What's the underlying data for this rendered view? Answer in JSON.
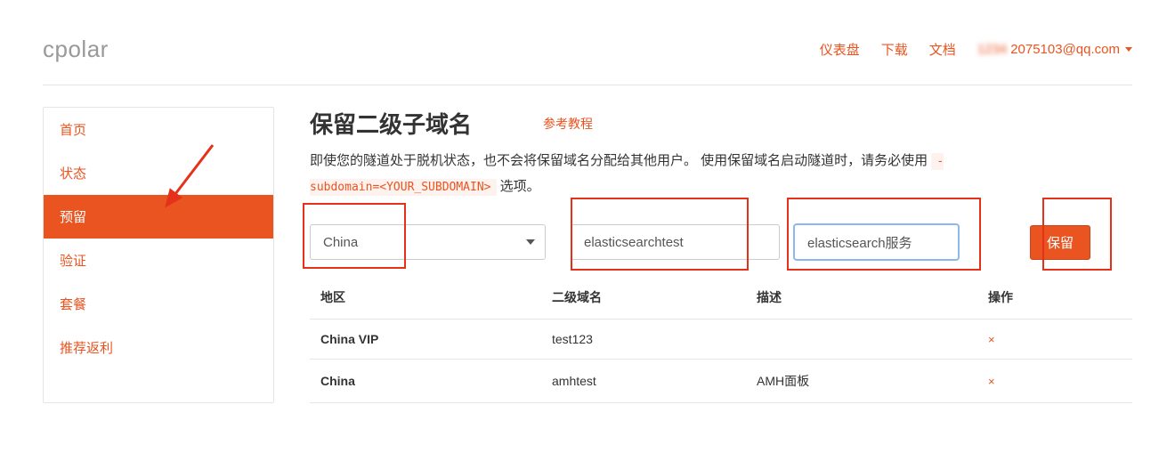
{
  "brand": "cpolar",
  "nav": {
    "dashboard": "仪表盘",
    "download": "下载",
    "docs": "文档",
    "user_email_blur": "1234",
    "user_email_tail": "2075103@qq.com"
  },
  "sidebar": {
    "items": [
      {
        "label": "首页"
      },
      {
        "label": "状态"
      },
      {
        "label": "预留"
      },
      {
        "label": "验证"
      },
      {
        "label": "套餐"
      },
      {
        "label": "推荐返利"
      }
    ],
    "active_index": 2
  },
  "main": {
    "title": "保留二级子域名",
    "reference_link": "参考教程",
    "desc_prefix": "即使您的隧道处于脱机状态，也不会将保留域名分配给其他用户。 使用保留域名启动隧道时，请务必使用 ",
    "desc_code": "-subdomain=<YOUR_SUBDOMAIN>",
    "desc_suffix": " 选项。"
  },
  "form": {
    "region_value": "China",
    "subdomain_value": "elasticsearchtest",
    "description_value": "elasticsearch服务",
    "reserve_label": "保留"
  },
  "table": {
    "headers": {
      "region": "地区",
      "subdomain": "二级域名",
      "description": "描述",
      "action": "操作"
    },
    "rows": [
      {
        "region": "China VIP",
        "subdomain": "test123",
        "description": ""
      },
      {
        "region": "China",
        "subdomain": "amhtest",
        "description": "AMH面板"
      }
    ],
    "delete_glyph": "×"
  }
}
